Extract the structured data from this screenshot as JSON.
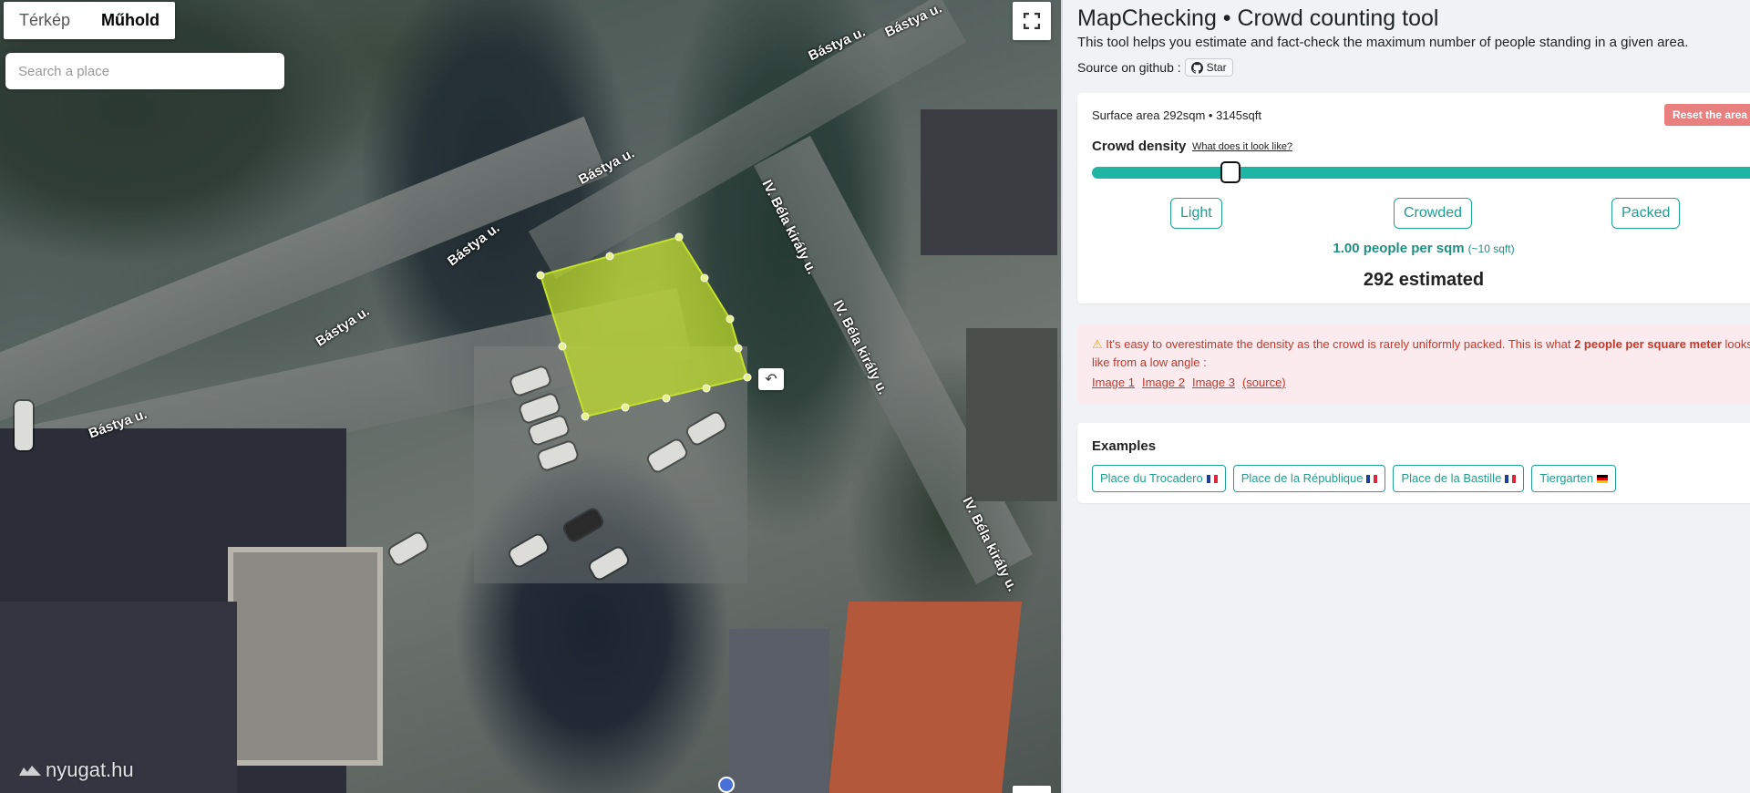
{
  "map": {
    "toggle": {
      "map_label": "Térkép",
      "satellite_label": "Műhold"
    },
    "search": {
      "placeholder": "Search a place"
    },
    "labels": {
      "street1": "Bástya u.",
      "street2": "Bástya u.",
      "street3": "Bástya u.",
      "street4": "Bástya u.",
      "street5": "Bástya u.",
      "street6": "Bástya u.",
      "street7": "IV. Béla király u.",
      "street8": "IV. Béla király u.",
      "street9": "IV. Béla király u."
    },
    "watermark": "nyugat.hu",
    "polygon_color": "#c4e22a"
  },
  "panel": {
    "title": "MapChecking • Crowd counting tool",
    "description": "This tool helps you estimate and fact-check the maximum number of people standing in a given area.",
    "github_label": "Source on github :",
    "star_label": "Star",
    "density_card": {
      "surface_area": "Surface area 292sqm • 3145sqft",
      "reset_label": "Reset the area",
      "density_label": "Crowd density",
      "density_link": "What does it look like?",
      "slider_value": 0.2,
      "options": [
        "Light",
        "Crowded",
        "Packed"
      ],
      "per_sqm": "1.00 people per sqm",
      "per_sqm_sub": "(~10 sqft)",
      "estimated": "292 estimated"
    },
    "warning": {
      "text_before": "It's easy to overestimate the density as the crowd is rarely uniformly packed. This is what ",
      "text_bold": "2 people per square meter",
      "text_after": " looks like from a low angle :",
      "links": [
        "Image 1",
        "Image 2",
        "Image 3",
        "(source)"
      ]
    },
    "examples": {
      "title": "Examples",
      "items": [
        {
          "label": "Place du Trocadero",
          "flag": "fr"
        },
        {
          "label": "Place de la République",
          "flag": "fr"
        },
        {
          "label": "Place de la Bastille",
          "flag": "fr"
        },
        {
          "label": "Tiergarten",
          "flag": "de"
        }
      ]
    },
    "colors": {
      "accent": "#1fb5a5",
      "reset": "#e7807e",
      "warning_bg": "#fcebee",
      "warning_text": "#c0392b"
    }
  }
}
